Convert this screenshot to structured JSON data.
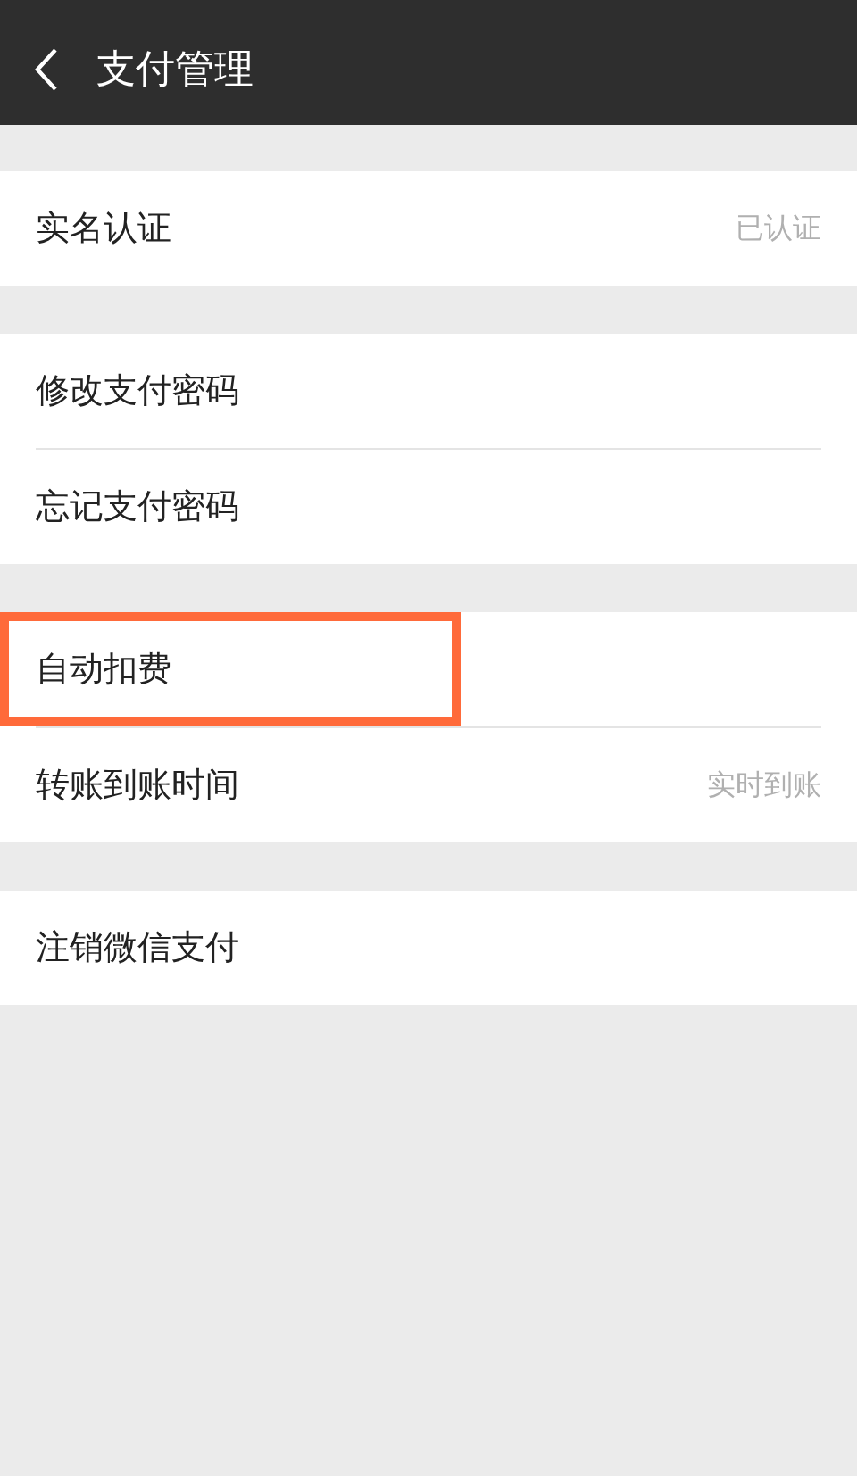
{
  "header": {
    "title": "支付管理"
  },
  "groups": [
    {
      "items": [
        {
          "label": "实名认证",
          "value": "已认证",
          "highlighted": false
        }
      ]
    },
    {
      "items": [
        {
          "label": "修改支付密码",
          "highlighted": false
        },
        {
          "label": "忘记支付密码",
          "highlighted": false
        }
      ]
    },
    {
      "items": [
        {
          "label": "自动扣费",
          "highlighted": true
        },
        {
          "label": "转账到账时间",
          "value": "实时到账",
          "highlighted": false
        }
      ]
    },
    {
      "items": [
        {
          "label": "注销微信支付",
          "highlighted": false
        }
      ]
    }
  ]
}
